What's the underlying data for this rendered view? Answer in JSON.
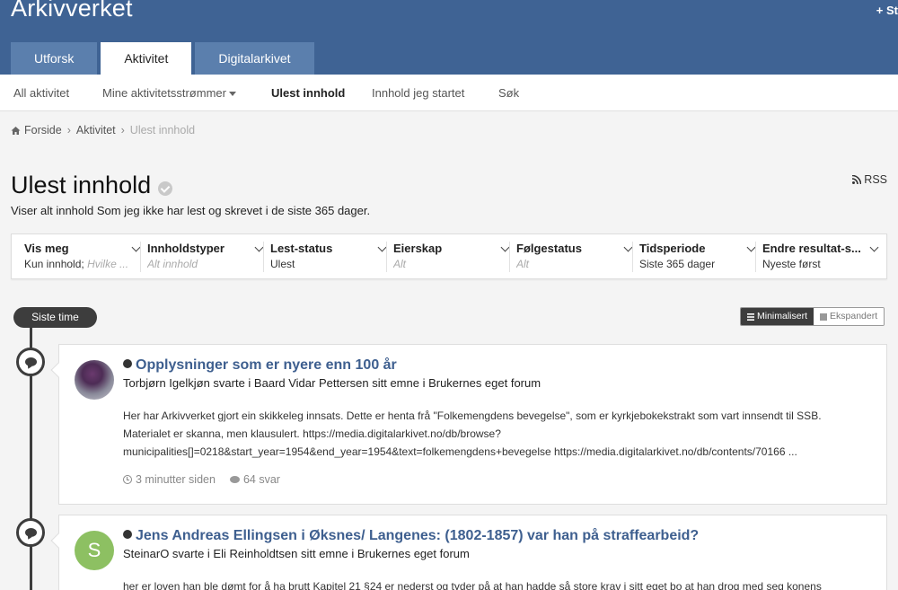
{
  "header": {
    "site_title": "Arkivverket",
    "action_label": "+ St",
    "tabs": [
      {
        "label": "Utforsk"
      },
      {
        "label": "Aktivitet"
      },
      {
        "label": "Digitalarkivet"
      }
    ]
  },
  "subnav": {
    "items": [
      {
        "label": "All aktivitet"
      },
      {
        "label": "Mine aktivitetsstrømmer"
      },
      {
        "label": "Ulest innhold"
      },
      {
        "label": "Innhold jeg startet"
      },
      {
        "label": "Søk"
      }
    ]
  },
  "breadcrumb": {
    "items": [
      "Forside",
      "Aktivitet",
      "Ulest innhold"
    ],
    "separator": "›"
  },
  "page": {
    "title": "Ulest innhold",
    "description": "Viser alt innhold Som jeg ikke har lest og skrevet i de siste 365 dager.",
    "rss_label": "RSS"
  },
  "filters": [
    {
      "label": "Vis meg",
      "value": "Kun innhold;",
      "value_muted": "Hvilke ..."
    },
    {
      "label": "Innholdstyper",
      "value": "",
      "value_muted": "Alt innhold"
    },
    {
      "label": "Lest-status",
      "value": "Ulest",
      "value_muted": ""
    },
    {
      "label": "Eierskap",
      "value": "",
      "value_muted": "Alt"
    },
    {
      "label": "Følgestatus",
      "value": "",
      "value_muted": "Alt"
    },
    {
      "label": "Tidsperiode",
      "value": "Siste 365 dager",
      "value_muted": ""
    },
    {
      "label": "Endre resultat-s...",
      "value": "Nyeste først",
      "value_muted": ""
    }
  ],
  "timeline": {
    "time_label": "Siste time",
    "view_minimized": "Minimalisert",
    "view_expanded": "Ekspandert"
  },
  "posts": [
    {
      "title": "Opplysninger som er nyere enn 100 år",
      "subtitle": "Torbjørn Igelkjøn svarte i Baard Vidar Pettersen sitt emne i Brukernes eget forum",
      "body_line1": "Her har Arkivverket gjort ein skikkeleg innsats. Dette er henta frå \"Folkemengdens bevegelse\", som er kyrkjebokekstrakt som vart innsendt til SSB.",
      "body_line2": "Materialet er skanna, men klausulert. https://media.digitalarkivet.no/db/browse?",
      "body_line3": "municipalities[]=0218&start_year=1954&end_year=1954&text=folkemengdens+bevegelse https://media.digitalarkivet.no/db/contents/70166 ...",
      "time": "3 minutter siden",
      "replies": "64 svar"
    },
    {
      "title": "Jens Andreas Ellingsen i Øksnes/ Langenes: (1802-1857) var han på straffearbeid?",
      "subtitle": "SteinarO svarte i Eli Reinholdtsen sitt emne i Brukernes eget forum",
      "avatar_letter": "S",
      "body_line1": "her er loven han ble dømt for å ha brutt Kapitel 21 §24 er nederst og tyder på at han hadde så store krav i sitt eget bo at han drog med seg konens"
    }
  ],
  "colors": {
    "header_bg": "#3f6394",
    "link": "#3e5f8f",
    "timeline": "#3d3d3d",
    "avatar_green": "#8dc062"
  }
}
